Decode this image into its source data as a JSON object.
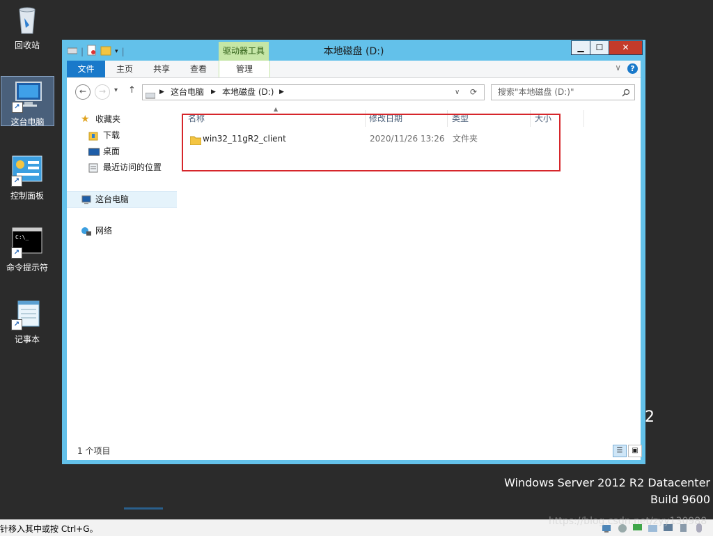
{
  "desktop": {
    "icons": [
      {
        "label": "回收站",
        "icon": "recycle-bin-icon"
      },
      {
        "label": "这台电脑",
        "icon": "computer-icon"
      },
      {
        "label": "控制面板",
        "icon": "control-panel-icon"
      },
      {
        "label": "命令提示符",
        "icon": "cmd-icon"
      },
      {
        "label": "记事本",
        "icon": "notepad-icon"
      }
    ],
    "side_number": "2",
    "watermark_line1": "Windows Server 2012 R2 Datacenter",
    "watermark_line2": "Build 9600"
  },
  "window": {
    "title": "本地磁盘 (D:)",
    "context_tab": "驱动器工具",
    "controls": {
      "minimize": "▁",
      "maximize": "☐",
      "close": "✕"
    }
  },
  "ribbon": {
    "tabs": [
      "文件",
      "主页",
      "共享",
      "查看",
      "管理"
    ],
    "help": "?",
    "collapse": "∨"
  },
  "navigation": {
    "back": "←",
    "forward": "→",
    "recent": "▾",
    "up": "↑",
    "breadcrumb": [
      "这台电脑",
      "本地磁盘 (D:)"
    ],
    "search_placeholder": "搜索\"本地磁盘 (D:)\""
  },
  "nav_pane": {
    "favorites": "收藏夹",
    "favorite_items": [
      "下载",
      "桌面",
      "最近访问的位置"
    ],
    "this_pc": "这台电脑",
    "network": "网络"
  },
  "file_list": {
    "columns": [
      "名称",
      "修改日期",
      "类型",
      "大小"
    ],
    "rows": [
      {
        "name": "win32_11gR2_client",
        "modified": "2020/11/26 13:26",
        "type": "文件夹",
        "size": ""
      }
    ]
  },
  "status": {
    "item_count": "1 个项目"
  },
  "taskbar": {
    "text": "针移入其中或按 Ctrl+G。",
    "blog_mark": "https://blog.csdn.net/zyy130988"
  },
  "colors": {
    "window_frame": "#63c1ea",
    "file_tab": "#1979ca",
    "context_tab": "#c5e6a6",
    "close_button": "#c43b2a",
    "highlight_box": "#d6262b"
  }
}
